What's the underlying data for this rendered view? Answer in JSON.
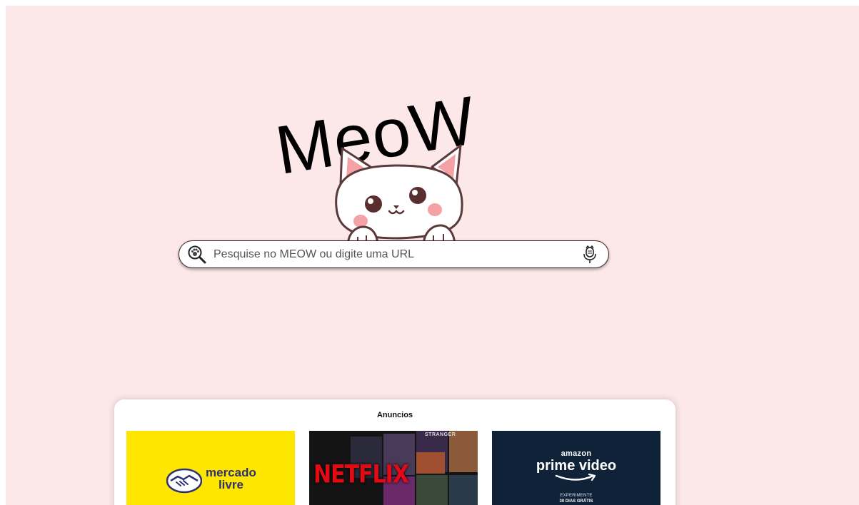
{
  "logo": {
    "text": "MeoW"
  },
  "search": {
    "placeholder": "Pesquise no MEOW ou digite uma URL",
    "value": ""
  },
  "ads": {
    "title": "Anuncios",
    "items": [
      {
        "brand": "mercado livre",
        "line1": "mercado",
        "line2": "livre"
      },
      {
        "brand": "NETFLIX",
        "logo": "NETFLIX",
        "poster_text": "STRANGER"
      },
      {
        "brand": "amazon prime video",
        "line1": "amazon",
        "line2": "prime video",
        "tagline": "EXPERIMENTE",
        "offer": "30 DIAS GRÁTIS"
      }
    ]
  },
  "colors": {
    "background": "#fce8e8",
    "mercado_livre": "#ffe600",
    "netflix_red": "#e50914",
    "prime_blue": "#0f2238",
    "cat_cheek": "#f4a2a6"
  },
  "icons": [
    "magnifier-paw-icon",
    "microphone-icon",
    "cat-mascot",
    "handshake-icon",
    "amazon-smile-icon"
  ]
}
